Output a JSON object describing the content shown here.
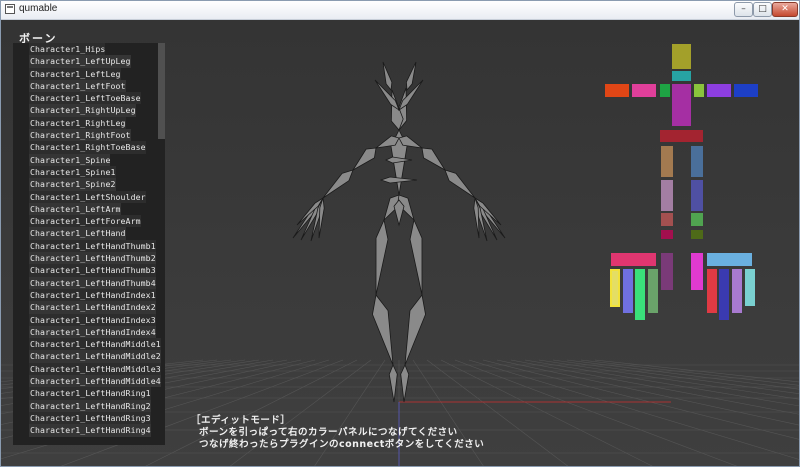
{
  "window": {
    "title": "qumable",
    "btn_min": "–",
    "btn_max": "□",
    "btn_close": "✕"
  },
  "bone_panel": {
    "label": "ボーン",
    "items": [
      "Character1_Hips",
      "Character1_LeftUpLeg",
      "Character1_LeftLeg",
      "Character1_LeftFoot",
      "Character1_LeftToeBase",
      "Character1_RightUpLeg",
      "Character1_RightLeg",
      "Character1_RightFoot",
      "Character1_RightToeBase",
      "Character1_Spine",
      "Character1_Spine1",
      "Character1_Spine2",
      "Character1_LeftShoulder",
      "Character1_LeftArm",
      "Character1_LeftForeArm",
      "Character1_LeftHand",
      "Character1_LeftHandThumb1",
      "Character1_LeftHandThumb2",
      "Character1_LeftHandThumb3",
      "Character1_LeftHandThumb4",
      "Character1_LeftHandIndex1",
      "Character1_LeftHandIndex2",
      "Character1_LeftHandIndex3",
      "Character1_LeftHandIndex4",
      "Character1_LeftHandMiddle1",
      "Character1_LeftHandMiddle2",
      "Character1_LeftHandMiddle3",
      "Character1_LeftHandMiddle4",
      "Character1_LeftHandRing1",
      "Character1_LeftHandRing2",
      "Character1_LeftHandRing3",
      "Character1_LeftHandRing4"
    ]
  },
  "edit_message": {
    "line1": "［エディットモード］",
    "line2": "ボーンを引っぱって右のカラーパネルにつなげてください",
    "line3": "つなげ終わったらプラグインのconnectボタンをしてください"
  },
  "color_panel": {
    "head": "#a3a02a",
    "neck": "#27a3a3",
    "chest": "#a52fa3",
    "left_arm": [
      "#e04616",
      "#e03f9a",
      "#1ea344"
    ],
    "right_arm": [
      "#8ac43c",
      "#8d3ee0",
      "#1d3fc6"
    ],
    "hips": "#a32430",
    "left_leg": [
      "#a37a50",
      "#a37ea3",
      "#a35050",
      "#a30f4e"
    ],
    "right_leg": [
      "#4a6f9a",
      "#4f50a3",
      "#50a350",
      "#4e6a18"
    ],
    "left_hand_palm": "#e03670",
    "left_thumb": "#7a3a78",
    "left_fingers": [
      "#e4de64",
      "#7070e0",
      "#3ae07a",
      "#6aa36a"
    ],
    "right_hand_palm": "#6ab0e0",
    "right_thumb": "#e03ad0",
    "right_fingers": [
      "#e03a44",
      "#3a3ab0",
      "#a87ad0",
      "#7ad0d0"
    ]
  }
}
